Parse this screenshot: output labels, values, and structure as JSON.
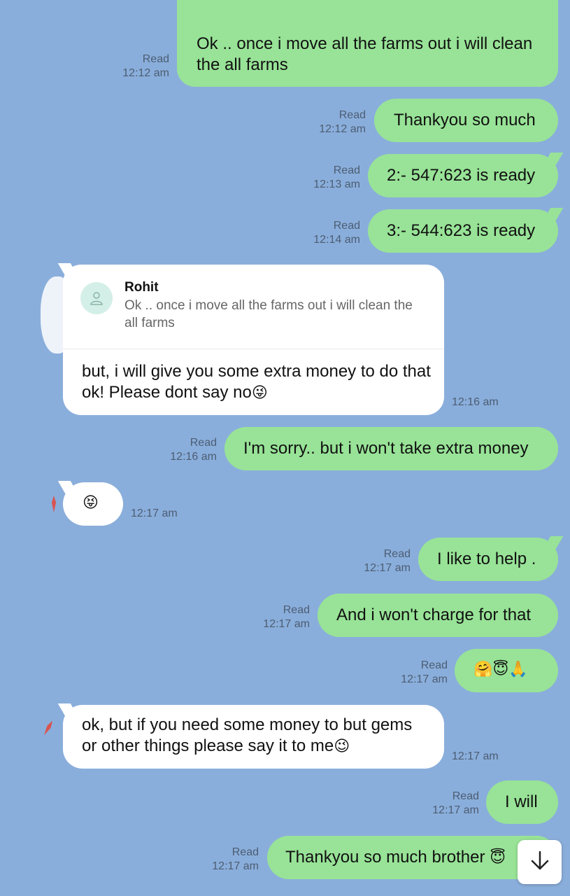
{
  "messages": [
    {
      "id": "m1",
      "text": "Ok .. once i move all the farms out i will clean the all farms",
      "status": "Read",
      "time": "12:12 am"
    },
    {
      "id": "m2",
      "text": "Thankyou so much",
      "status": "Read",
      "time": "12:12 am"
    },
    {
      "id": "m3",
      "text": "2:- 547:623 is ready",
      "status": "Read",
      "time": "12:13 am"
    },
    {
      "id": "m4",
      "text": "3:- 544:623 is ready",
      "status": "Read",
      "time": "12:14 am"
    },
    {
      "id": "m5",
      "reply_to": {
        "name": "Rohit",
        "text": "Ok .. once i move all the farms out i will clean the all farms"
      },
      "text": "but, i will give you some extra money to do that ok! Please dont say no",
      "emoji": "😜",
      "time": "12:16 am"
    },
    {
      "id": "m6",
      "text": "I'm sorry.. but i won't take extra money",
      "status": "Read",
      "time": "12:16 am"
    },
    {
      "id": "m7",
      "emoji": "😝",
      "time": "12:17 am"
    },
    {
      "id": "m8",
      "text": "I like to help .",
      "status": "Read",
      "time": "12:17 am"
    },
    {
      "id": "m9",
      "text": "And i won't charge for that",
      "status": "Read",
      "time": "12:17 am"
    },
    {
      "id": "m10",
      "emoji": "🤗😇🙏",
      "status": "Read",
      "time": "12:17 am"
    },
    {
      "id": "m11",
      "text": "ok, but if you need some money to but gems or other things please say it to me",
      "emoji": "😉",
      "time": "12:17 am"
    },
    {
      "id": "m12",
      "text": "I will",
      "status": "Read",
      "time": "12:17 am"
    },
    {
      "id": "m13",
      "text": "Thankyou so much brother",
      "emoji": "😇",
      "status": "Read",
      "time": "12:17 am"
    }
  ],
  "icons": {
    "scroll_down": "arrow-down-icon",
    "quote_avatar": "person-icon"
  },
  "colors": {
    "background": "#8aaedb",
    "outgoing": "#98e397",
    "incoming": "#ffffff",
    "meta": "#4c5d73"
  }
}
